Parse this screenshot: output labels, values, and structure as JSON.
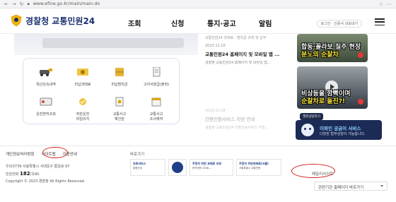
{
  "browser": {
    "url": "www.efine.go.kr/main/main.do"
  },
  "header": {
    "logo_text": "경찰청 교통민원24",
    "nav": [
      "조회",
      "신청",
      "통지·공고",
      "알림"
    ],
    "util": [
      "로그인",
      "인증서 내보내기"
    ]
  },
  "services": [
    {
      "label": "최근단속내역",
      "icon": "car-camera-icon"
    },
    {
      "label": "미납과태료",
      "icon": "money-icon"
    },
    {
      "label": "미납범칙금",
      "icon": "money-stack-icon"
    },
    {
      "label": "고지서발급(출력)",
      "icon": "document-icon"
    },
    {
      "label": "운전면허조회",
      "icon": "license-card-icon"
    },
    {
      "label": "착한운전\n마일리지",
      "icon": "mileage-icon"
    },
    {
      "label": "교통사고\n확인원",
      "icon": "accident-doc-icon"
    },
    {
      "label": "교통사고\n조사예약",
      "icon": "calendar-icon"
    }
  ],
  "news": {
    "top_snippet": "교통민원24 과태료 · 범칙금 조회 및 납부",
    "items": [
      {
        "date": "2023.11.10",
        "title": "교통민원24 홈페이지 및 모바일 앱 ...",
        "desc": "경찰청 교통민원24 홈페이지 및 모바일 앱...",
        "faded": false
      },
      {
        "date": "2023.11.08",
        "title": "간편인증서비스 지연 안내",
        "desc": "경찰청 교통민원24 간편인증서비스 지연...",
        "faded": true
      }
    ]
  },
  "videos": [
    {
      "caption_line1": "합동·꼴라보 질주 현장",
      "caption_line2": "분노의 순찰차"
    },
    {
      "caption_line1": "비상등을 깜빡이며",
      "caption_line2": "순찰차로 돌진?!"
    }
  ],
  "chatbot": {
    "tooltip": "챗봇상담하기",
    "title": "이파인 궁금이 서비스",
    "subtitle": "다양한 법무상담이 가능합니다."
  },
  "footer": {
    "links": [
      "개인정보처리방침",
      "사이트맵",
      "이용안내"
    ],
    "address_lines": [
      "우)03739 서울특별시 서대문구 통일로 97",
      "민원전화 182 (유료)",
      "Copyright © 2023 경찰청 All Rights Reserved."
    ],
    "phone_prefix": "민원전화",
    "phone_number": "182",
    "phone_suffix": "(유료)",
    "shortcut_title": "바로가기",
    "banners": [
      {
        "title": "조회서비스",
        "sub": "통합안내"
      },
      {
        "title": "",
        "sub": ""
      },
      {
        "title": "주정차 위반 과태료 조회",
        "sub": "문의전화 1588-..."
      },
      {
        "title": "주정차 위반과태료(서울)",
        "sub": "서울특별시 교통민원"
      }
    ],
    "family_title": "패밀리사이트",
    "related_select": "관련기관 홈페이지 바로가기"
  },
  "colors": {
    "brand": "#1a2f6e",
    "annotation": "#d32020"
  }
}
